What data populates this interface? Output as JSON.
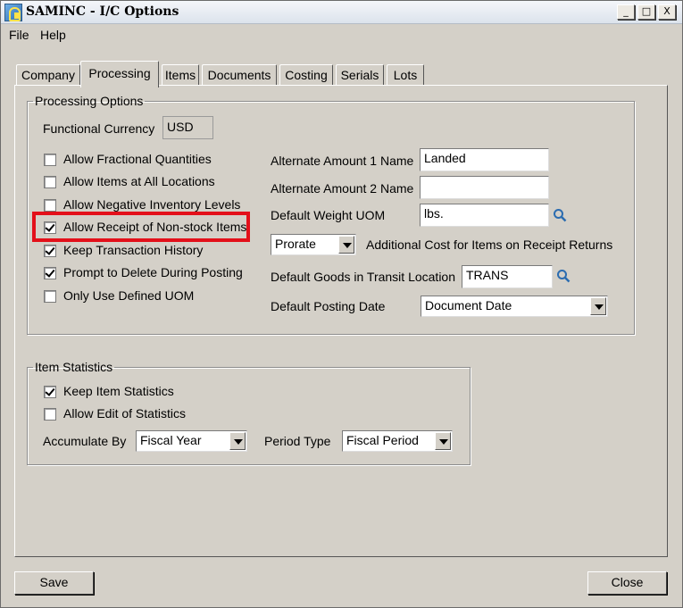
{
  "window": {
    "title": "SAMINC - I/C Options",
    "minimize": "_",
    "maximize": "□",
    "close": "X"
  },
  "menu": [
    "File",
    "Help"
  ],
  "tabs": [
    "Company",
    "Processing",
    "Items",
    "Documents",
    "Costing",
    "Serials",
    "Lots"
  ],
  "active_tab": "Processing",
  "processing": {
    "title": "Processing Options",
    "functional_currency_label": "Functional Currency",
    "functional_currency_value": "USD",
    "checkboxes": [
      {
        "label": "Allow Fractional Quantities",
        "checked": false
      },
      {
        "label": "Allow Items at All Locations",
        "checked": false
      },
      {
        "label": "Allow Negative Inventory Levels",
        "checked": false
      },
      {
        "label": "Allow Receipt of Non-stock Items",
        "checked": true
      },
      {
        "label": "Keep Transaction History",
        "checked": true
      },
      {
        "label": "Prompt to Delete During Posting",
        "checked": true
      },
      {
        "label": "Only Use Defined UOM",
        "checked": false
      }
    ],
    "alt_amount_1_label": "Alternate Amount 1 Name",
    "alt_amount_1_value": "Landed",
    "alt_amount_2_label": "Alternate Amount 2 Name",
    "alt_amount_2_value": "",
    "default_weight_uom_label": "Default Weight UOM",
    "default_weight_uom_value": "lbs.",
    "additional_cost_value": "Prorate",
    "additional_cost_label": "Additional Cost for Items on Receipt Returns",
    "goods_in_transit_label": "Default Goods in Transit Location",
    "goods_in_transit_value": "TRANS",
    "posting_date_label": "Default Posting Date",
    "posting_date_value": "Document Date"
  },
  "item_statistics": {
    "title": "Item Statistics",
    "checkboxes": [
      {
        "label": "Keep Item Statistics",
        "checked": true
      },
      {
        "label": "Allow Edit of Statistics",
        "checked": false
      }
    ],
    "accumulate_by_label": "Accumulate By",
    "accumulate_by_value": "Fiscal Year",
    "period_type_label": "Period Type",
    "period_type_value": "Fiscal Period"
  },
  "buttons": {
    "save": "Save",
    "close": "Close"
  },
  "colors": {
    "highlight": "#e3101a",
    "dialog": "#d4d0c8",
    "magnifier": "#2b6cb0"
  }
}
